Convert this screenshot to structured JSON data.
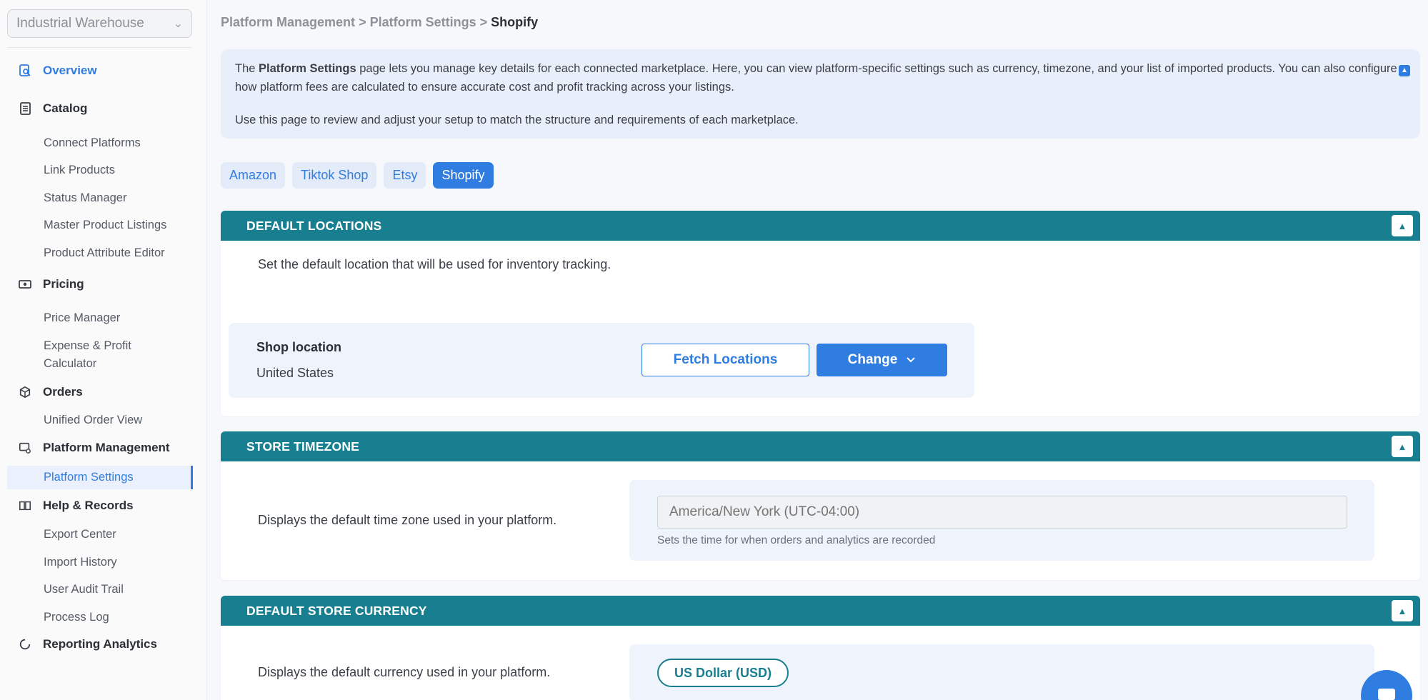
{
  "store_selector": {
    "value": "Industrial Warehouse"
  },
  "sidebar": {
    "overview": "Overview",
    "catalog": {
      "label": "Catalog",
      "items": [
        "Connect Platforms",
        "Link Products",
        "Status Manager",
        "Master Product Listings",
        "Product Attribute Editor"
      ]
    },
    "pricing": {
      "label": "Pricing",
      "items": [
        "Price Manager",
        "Expense & Profit",
        "Calculator"
      ]
    },
    "orders": {
      "label": "Orders",
      "items": [
        "Unified Order View"
      ]
    },
    "platform_management": {
      "label": "Platform Management",
      "items": [
        "Platform Settings"
      ]
    },
    "help_records": {
      "label": "Help & Records",
      "items": [
        "Export Center",
        "Import History",
        "User Audit Trail",
        "Process Log"
      ]
    },
    "reporting": "Reporting Analytics"
  },
  "breadcrumb": {
    "part1": "Platform Management",
    "sep": ">",
    "part2": "Platform Settings",
    "current": "Shopify"
  },
  "info": {
    "line1_prefix": "The",
    "line1_bold": "Platform Settings",
    "line1_rest": "page lets you manage key details for each connected marketplace. Here, you can view platform-specific settings such as currency, timezone, and your list of imported products. You can also configure how platform fees are calculated to ensure accurate cost and profit tracking across your listings.",
    "line2": "Use this page to review and adjust your setup to match the structure and requirements of each marketplace."
  },
  "tabs": [
    "Amazon",
    "Tiktok Shop",
    "Etsy",
    "Shopify"
  ],
  "default_locations": {
    "title": "DEFAULT LOCATIONS",
    "description": "Set the default location that will be used for inventory tracking.",
    "shop_location_label": "Shop location",
    "shop_location_value": "United States",
    "fetch_button": "Fetch Locations",
    "change_button": "Change"
  },
  "store_timezone": {
    "title": "STORE TIMEZONE",
    "description": "Displays the default time zone used in your platform.",
    "placeholder": "America/New York (UTC-04:00)",
    "help": "Sets the time for when orders and analytics are recorded"
  },
  "default_currency": {
    "title": "DEFAULT STORE CURRENCY",
    "description": "Displays the default currency used in your platform.",
    "value": "US Dollar (USD)"
  },
  "colors": {
    "accent": "#2f7de1",
    "header_teal": "#177f8f"
  }
}
